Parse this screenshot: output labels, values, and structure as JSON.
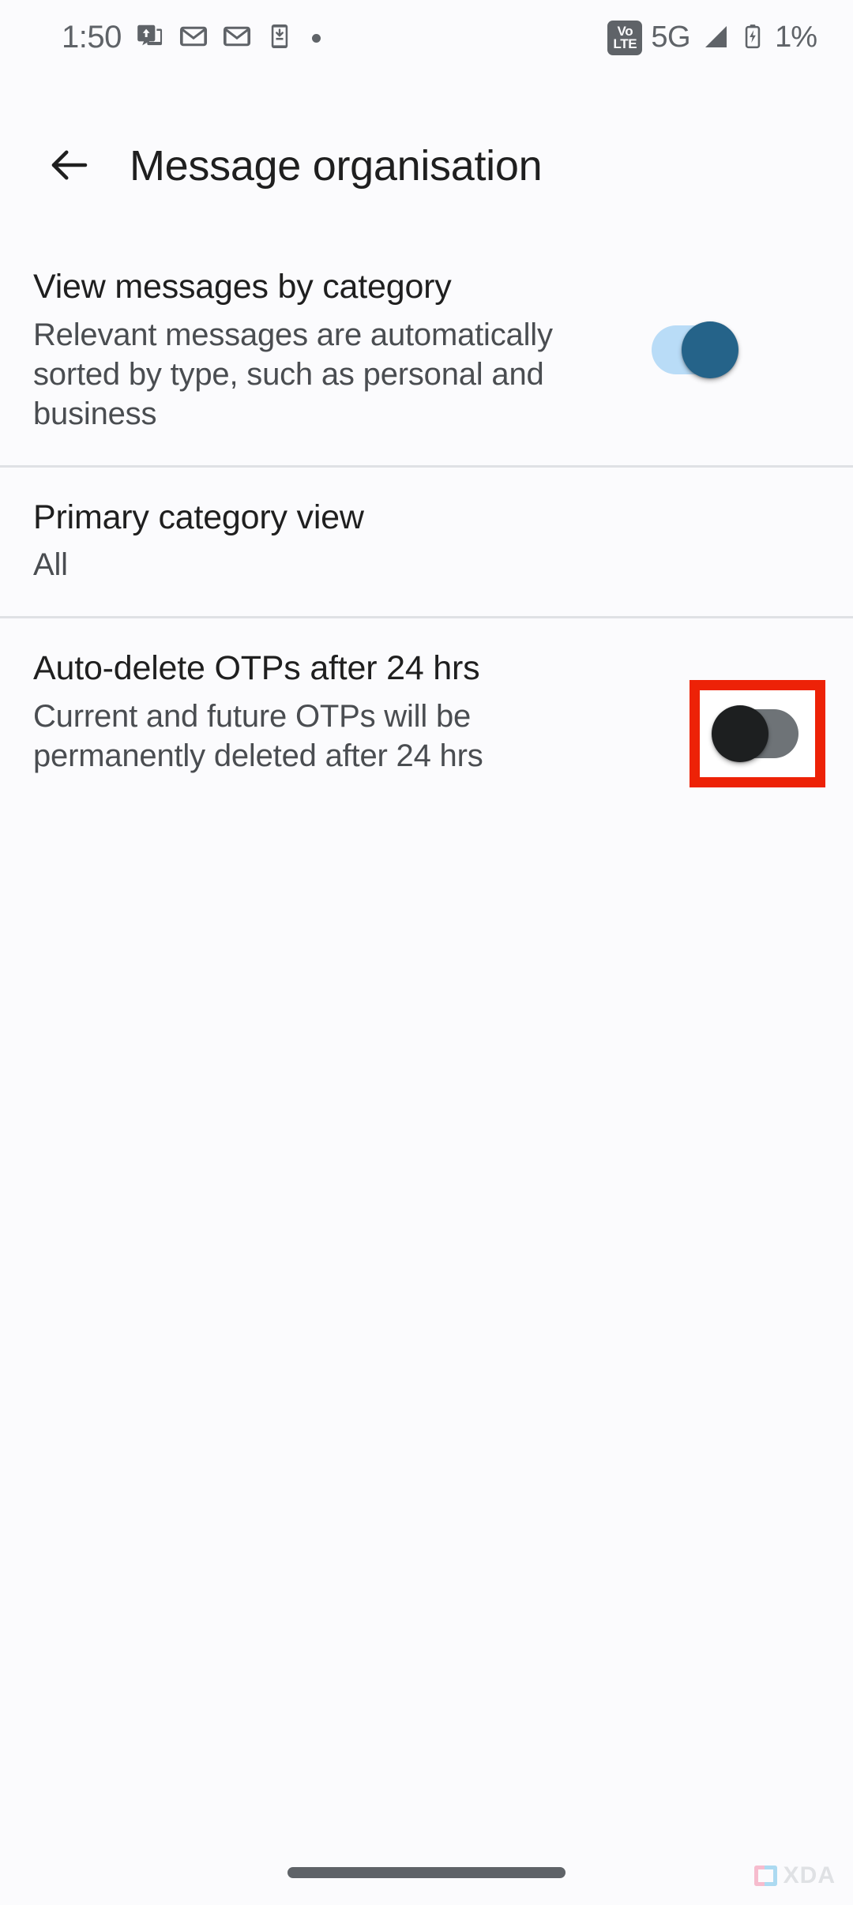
{
  "status_bar": {
    "clock": "1:50",
    "icons_left": [
      {
        "name": "screen-share-icon",
        "label": "screen share"
      },
      {
        "name": "gmail-icon",
        "label": "Gmail"
      },
      {
        "name": "gmail-icon-2",
        "label": "Gmail"
      },
      {
        "name": "download-to-phone-icon",
        "label": "download to device"
      },
      {
        "name": "overflow-dot-icon",
        "label": "more notifications"
      }
    ],
    "volte_top": "Vo",
    "volte_bottom": "LTE",
    "network": "5G",
    "signal_icon": "signal-bars-icon",
    "battery_icon": "battery-charging-icon",
    "battery_percent": "1%"
  },
  "app_bar": {
    "back_icon": "back-arrow-icon",
    "title": "Message organisation"
  },
  "settings": {
    "rows": [
      {
        "title": "View messages by category",
        "summary": "Relevant messages are automatically sorted by type, such as personal and business",
        "control": "switch",
        "state": "on"
      },
      {
        "title": "Primary category view",
        "summary": "All",
        "control": "none",
        "state": ""
      },
      {
        "title": "Auto-delete OTPs after 24 hrs",
        "summary": "Current and future OTPs will be permanently deleted after 24 hrs",
        "control": "switch",
        "state": "off"
      }
    ]
  },
  "annotation": {
    "highlight_color": "#ed2207",
    "target": "auto-delete-otps-switch"
  },
  "watermark": {
    "text": "XDA"
  },
  "colors": {
    "background": "#fbfbfd",
    "title_text": "#1f1f1f",
    "summary_text": "#4a4d51",
    "status_text": "#5f6368",
    "divider": "#dfe1e5",
    "switch_on_track": "#b9dcf7",
    "switch_on_thumb": "#256389",
    "switch_off_track": "#6e7377",
    "switch_off_thumb": "#1d1f20",
    "nav_pill": "#5f6368"
  }
}
